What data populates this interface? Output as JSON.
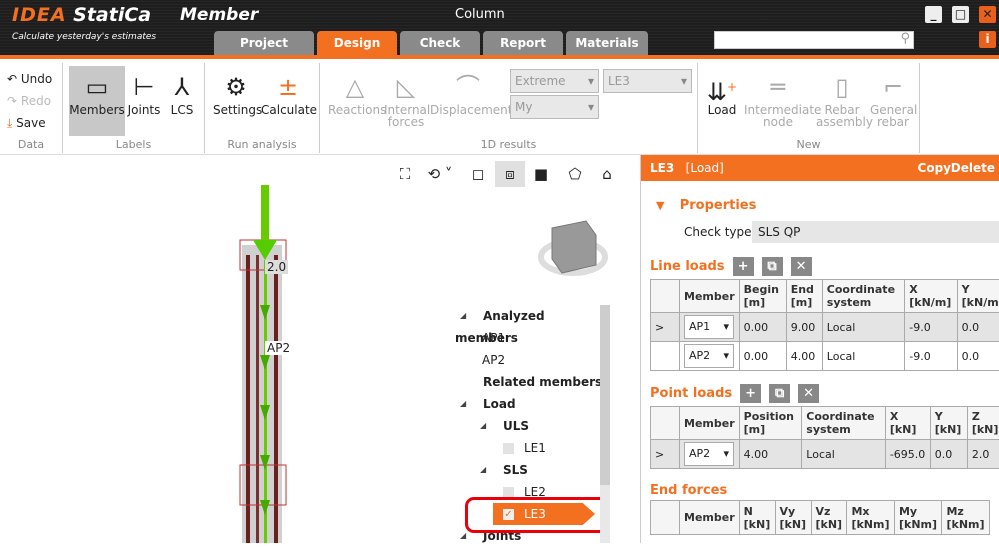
{
  "app": {
    "logo_brand": "IDEA",
    "logo_name": "StatiCa",
    "product": "Member",
    "tagline": "Calculate yesterday's estimates",
    "window_title": "Column"
  },
  "tabs": [
    "Project",
    "Design",
    "Check",
    "Report",
    "Materials"
  ],
  "search": {
    "placeholder": ""
  },
  "window_buttons": {
    "min": "_",
    "max": "□",
    "close": "✕",
    "info": "i"
  },
  "ribbon": {
    "data": {
      "undo": "Undo",
      "redo": "Redo",
      "save": "Save",
      "label": "Data"
    },
    "labels": {
      "members": "Members",
      "joints": "Joints",
      "lcs": "LCS",
      "label": "Labels"
    },
    "run": {
      "settings": "Settings",
      "calculate": "Calculate",
      "label": "Run analysis"
    },
    "results": {
      "reactions": "Reactions",
      "internal": "Internal",
      "forces": "forces",
      "displacement": "Displacement",
      "extreme": "Extreme",
      "le": "LE3",
      "my": "My",
      "label": "1D results"
    },
    "new": {
      "load": "Load",
      "intermediate": "Intermediate",
      "node": "node",
      "rebar": "Rebar",
      "assembly": "assembly",
      "general": "General",
      "grebar": "rebar",
      "label": "New"
    }
  },
  "viewport": {
    "load_value": "2.0",
    "member_label": "AP2"
  },
  "tree": {
    "analyzed": "Analyzed members",
    "ap1": "AP1",
    "ap2": "AP2",
    "related": "Related members",
    "load": "Load",
    "uls": "ULS",
    "le1": "LE1",
    "sls": "SLS",
    "le2": "LE2",
    "le3": "LE3",
    "joints": "Joints"
  },
  "panel": {
    "title": "LE3",
    "subtitle": "[Load]",
    "copy": "Copy",
    "delete": "Delete",
    "properties": "Properties",
    "check_type_label": "Check type",
    "check_type": "SLS QP",
    "line_loads": {
      "title": "Line loads",
      "headers": [
        "",
        "Member",
        "Begin [m]",
        "End [m]",
        "Coordinate system",
        "X [kN/m]",
        "Y [kN/m]"
      ],
      "rows": [
        [
          ">",
          "AP1",
          "0.00",
          "9.00",
          "Local",
          "-9.0",
          "0.0"
        ],
        [
          "",
          "AP2",
          "0.00",
          "4.00",
          "Local",
          "-9.0",
          "0.0"
        ]
      ]
    },
    "point_loads": {
      "title": "Point loads",
      "headers": [
        "",
        "Member",
        "Position [m]",
        "Coordinate system",
        "X [kN]",
        "Y [kN]",
        "Z [kN]"
      ],
      "rows": [
        [
          ">",
          "AP2",
          "4.00",
          "Local",
          "-695.0",
          "0.0",
          "2.0"
        ]
      ]
    },
    "end_forces": {
      "title": "End forces",
      "headers": [
        "",
        "Member",
        "N [kN]",
        "Vy [kN]",
        "Vz [kN]",
        "Mx [kNm]",
        "My [kNm]",
        "Mz [kNm]"
      ]
    }
  },
  "colors": {
    "accent": "#f37021",
    "highlight": "#e8000b",
    "load": "#66cc00"
  }
}
